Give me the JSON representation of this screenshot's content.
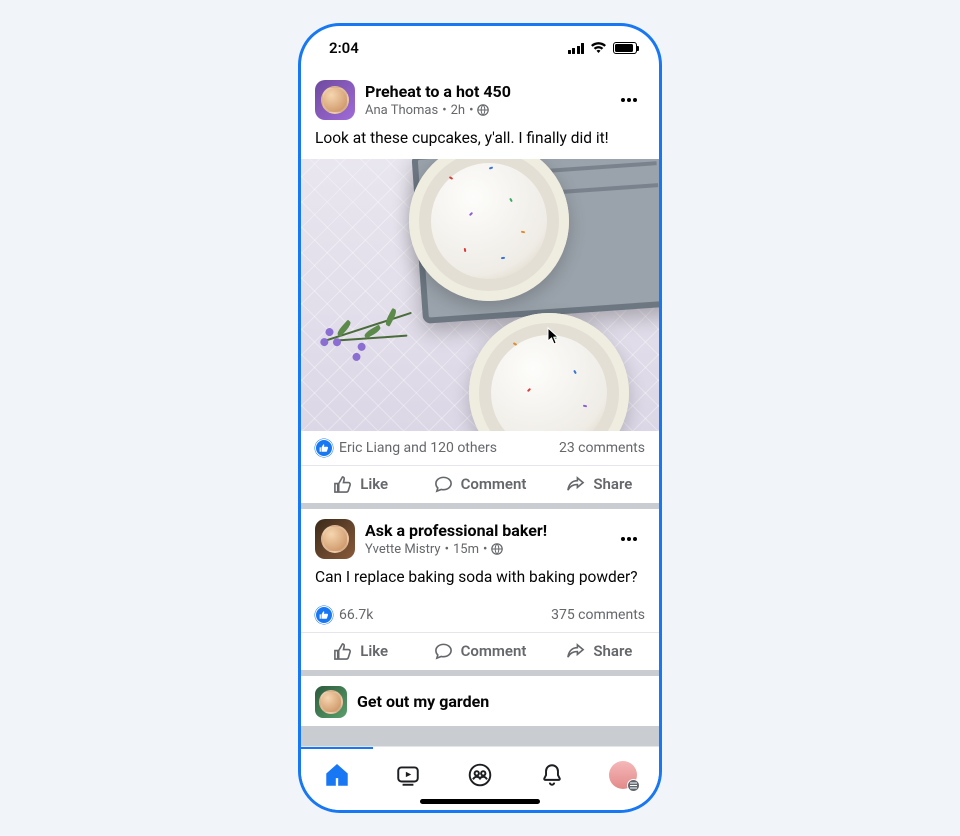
{
  "statusbar": {
    "time": "2:04"
  },
  "posts": [
    {
      "group": "Preheat to a hot 450",
      "author": "Ana Thomas",
      "age": "2h",
      "body": "Look at these cupcakes, y'all. I finally did it!",
      "reactions_text": "Eric Liang and 120 others",
      "comments_text": "23 comments"
    },
    {
      "group": "Ask a professional baker!",
      "author": "Yvette Mistry",
      "age": "15m",
      "body": "Can I replace baking soda with baking powder?",
      "reactions_text": "66.7k",
      "comments_text": "375 comments"
    },
    {
      "group": "Get out my garden"
    }
  ],
  "action_labels": {
    "like": "Like",
    "comment": "Comment",
    "share": "Share"
  },
  "meta_separator": "•"
}
